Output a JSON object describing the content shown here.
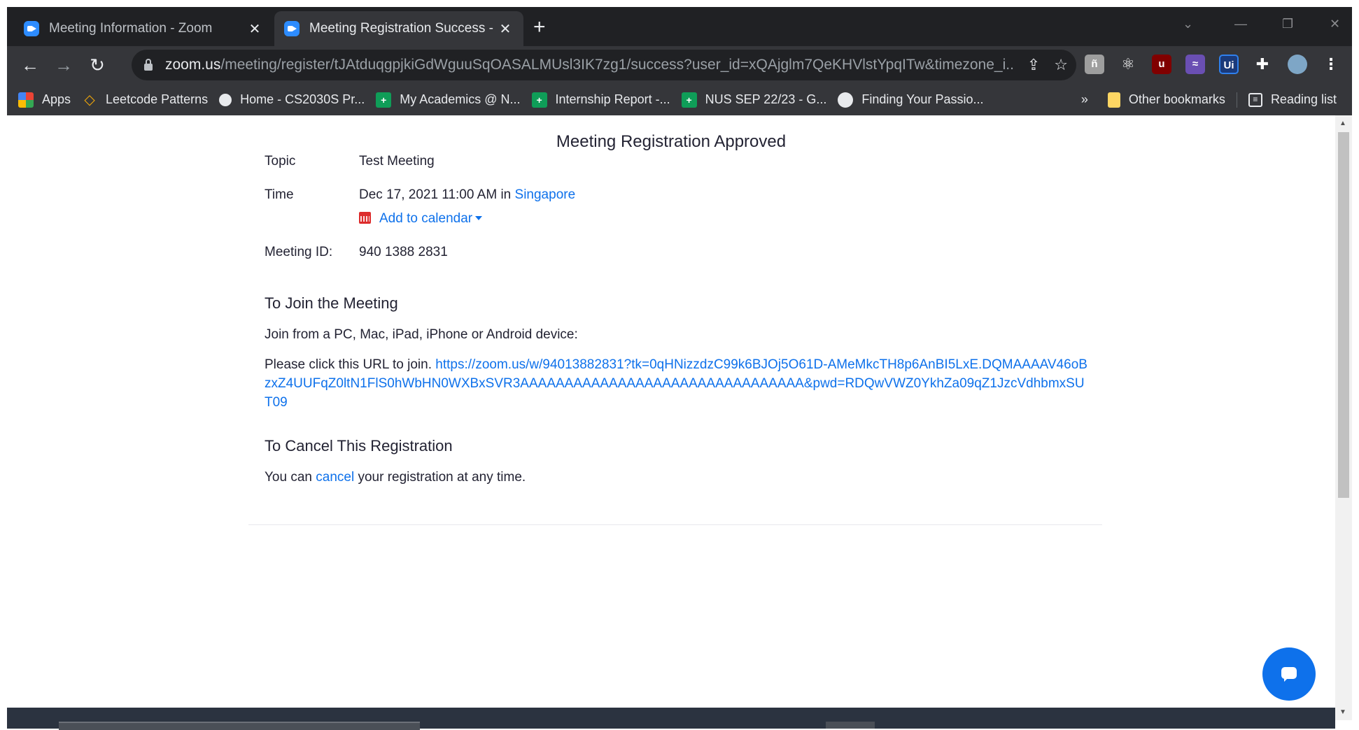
{
  "browser": {
    "tabs": [
      {
        "title": "Meeting Information - Zoom",
        "active": false
      },
      {
        "title": "Meeting Registration Success - Zoom",
        "active": true
      }
    ],
    "address": {
      "host": "zoom.us",
      "path": "/meeting/register/tJAtduqgpjkiGdWguuSqOASALMUsl3IK7zg1/success?user_id=xQAjglm7QeKHVlstYpqITw&timezone_i..."
    },
    "bookmarks": [
      {
        "label": "Apps",
        "icon": "apps-grid-icon"
      },
      {
        "label": "Leetcode Patterns",
        "icon": "leetcode-icon"
      },
      {
        "label": "Home - CS2030S Pr...",
        "icon": "github-icon"
      },
      {
        "label": "My Academics @ N...",
        "icon": "sheets-icon"
      },
      {
        "label": "Internship Report -...",
        "icon": "sheets-icon"
      },
      {
        "label": "NUS SEP 22/23 - G...",
        "icon": "sheets-icon"
      },
      {
        "label": "Finding Your Passio...",
        "icon": "globe-icon"
      }
    ],
    "overflow_label": "»",
    "other_bookmarks": "Other bookmarks",
    "reading_list": "Reading list"
  },
  "page": {
    "heading": "Meeting Registration Approved",
    "topic_label": "Topic",
    "topic_value": "Test Meeting",
    "time_label": "Time",
    "time_value": "Dec 17, 2021 11:00 AM",
    "time_in": "in",
    "timezone_link": "Singapore",
    "add_to_calendar": "Add to calendar",
    "meeting_id_label": "Meeting ID:",
    "meeting_id_value": "940 1388 2831",
    "join_heading": "To Join the Meeting",
    "join_devices": "Join from a PC, Mac, iPad, iPhone or Android device:",
    "join_url_prefix": "Please click this URL to join.",
    "join_url": "https://zoom.us/w/94013882831?tk=0qHNizzdzC99k6BJOj5O61D-AMeMkcTH8p6AnBI5LxE.DQMAAAAV46oBzxZ4UUFqZ0ltN1FlS0hWbHN0WXBxSVR3AAAAAAAAAAAAAAAAAAAAAAAAAAAAAAAA&pwd=RDQwVWZ0YkhZa09qZ1JzcVdhbmxSUT09",
    "cancel_heading": "To Cancel This Registration",
    "cancel_prefix": "You can",
    "cancel_link": "cancel",
    "cancel_suffix": "your registration at any time."
  },
  "colors": {
    "link": "#0e71eb",
    "chat_button": "#0e71eb",
    "browser_frame": "#202124",
    "toolbar": "#35363a"
  }
}
